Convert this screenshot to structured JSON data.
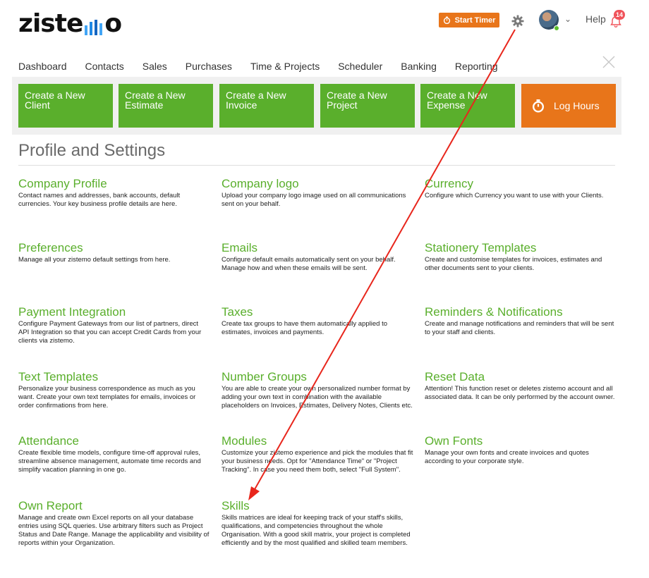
{
  "header": {
    "logo_prefix": "zist",
    "logo_suffix": "o",
    "start_timer": "Start Timer",
    "help": "Help",
    "notification_count": "14",
    "icons": {
      "timer": "stopwatch-icon",
      "gear": "gear-icon",
      "chevron": "chevron-down-icon",
      "bell": "bell-icon",
      "close": "close-icon"
    }
  },
  "nav": {
    "items": [
      "Dashboard",
      "Contacts",
      "Sales",
      "Purchases",
      "Time & Projects",
      "Scheduler",
      "Banking",
      "Reporting"
    ]
  },
  "quick_actions": [
    {
      "line1": "Create a New",
      "line2": "Client"
    },
    {
      "line1": "Create a New",
      "line2": "Estimate"
    },
    {
      "line1": "Create a New",
      "line2": "Invoice"
    },
    {
      "line1": "Create a New",
      "line2": "Project"
    },
    {
      "line1": "Create a New",
      "line2": "Expense"
    },
    {
      "label": "Log Hours"
    }
  ],
  "page": {
    "title": "Profile and Settings"
  },
  "settings": [
    {
      "title": "Company Profile",
      "desc": "Contact names and addresses, bank accounts, default currencies. Your key business profile details are here."
    },
    {
      "title": "Company logo",
      "desc": "Upload your company logo image used on all communications sent on your behalf."
    },
    {
      "title": "Currency",
      "desc": "Configure which Currency you want to use with your Clients."
    },
    {
      "title": "Preferences",
      "desc": "Manage all your zistemo default settings from here."
    },
    {
      "title": "Emails",
      "desc": "Configure default emails automatically sent on your behalf. Manage how and when these emails will be sent."
    },
    {
      "title": "Stationery Templates",
      "desc": "Create and customise templates for invoices, estimates and other documents sent to your clients."
    },
    {
      "title": "Payment Integration",
      "desc": "Configure Payment Gateways from our list of partners, direct API Integration so that you can accept Credit Cards from your clients via zistemo."
    },
    {
      "title": "Taxes",
      "desc": "Create tax groups to have them automatically applied to estimates, invoices and payments."
    },
    {
      "title": "Reminders & Notifications",
      "desc": "Create and manage notifications and reminders that will be sent to your staff and clients."
    },
    {
      "title": "Text Templates",
      "desc": "Personalize your business correspondence as much as you want. Create your own text templates for emails, invoices or order confirmations from here."
    },
    {
      "title": "Number Groups",
      "desc": "You are able to create your own personalized number format by adding your own text in combination with the available placeholders on Invoices, Estimates, Delivery Notes, Clients etc."
    },
    {
      "title": "Reset Data",
      "desc": "Attention! This function reset or deletes zistemo account and all associated data. It can be only performed by the account owner."
    },
    {
      "title": "Attendance",
      "desc": "Create flexible time models, configure time-off approval rules, streamline absence management, automate time records and simplify vacation planning in one go."
    },
    {
      "title": "Modules",
      "desc": "Customize your zistemo experience and pick the modules that fit your business needs. Opt for \"Attendance Time\" or \"Project Tracking\". In case you need them both, select \"Full System\"."
    },
    {
      "title": "Own Fonts",
      "desc": "Manage your own fonts and create invoices and quotes according to your corporate style."
    },
    {
      "title": "Own Report",
      "desc": "Manage and create own Excel reports on all your database entries using SQL queries. Use arbitrary filters such as Project Status and Date Range. Manage the applicability and visibility of reports within your Organization."
    },
    {
      "title": "Skills",
      "desc": "Skills matrices are ideal for keeping track of your staff's skills, qualifications, and competencies throughout the whole Organisation. With a good skill matrix, your project is completed efficiently and by the most qualified and skilled team members."
    }
  ],
  "colors": {
    "green": "#5aaf2c",
    "orange": "#e8751a",
    "annotation_arrow": "#e8261c",
    "badge": "#f0535a"
  }
}
